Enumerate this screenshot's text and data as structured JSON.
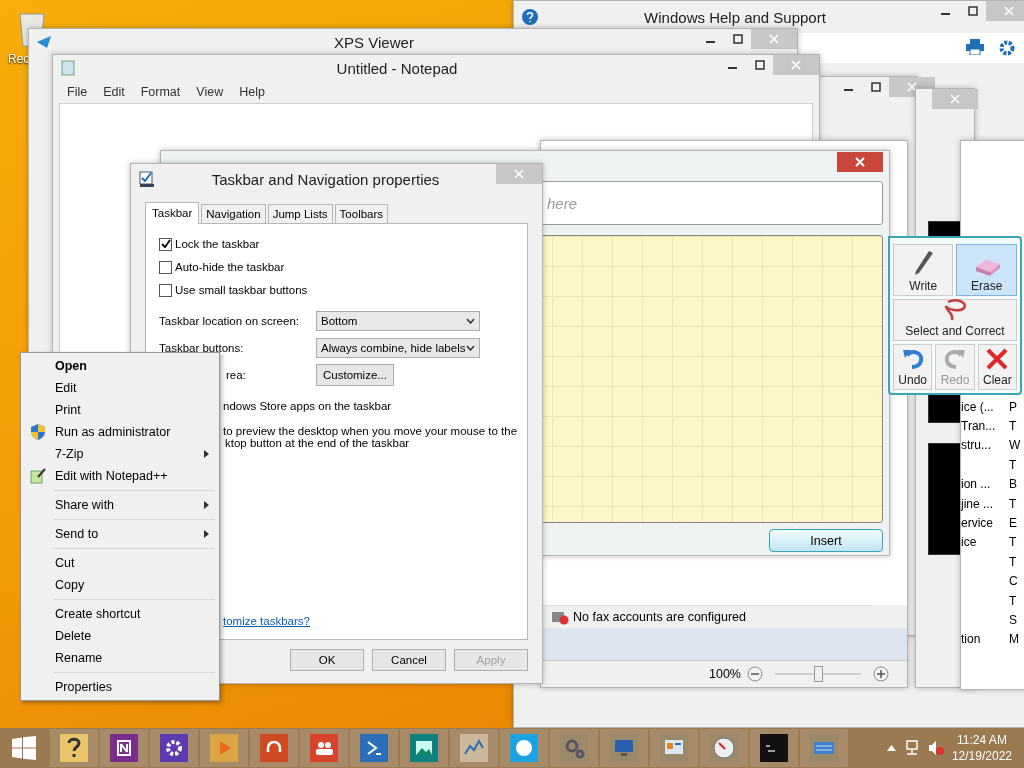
{
  "desktop": {
    "icons": [
      {
        "label": "Rec"
      }
    ]
  },
  "help_window": {
    "title": "Windows Help and Support"
  },
  "xps_viewer": {
    "title": "XPS Viewer"
  },
  "notepad": {
    "title": "Untitled - Notepad",
    "menu": [
      "File",
      "Edit",
      "Format",
      "View",
      "Help"
    ]
  },
  "math_input_panel": {
    "placeholder": "here",
    "insert_button": "Insert",
    "tools": [
      {
        "label": "Write",
        "kind": "write",
        "selected": false,
        "disabled": false
      },
      {
        "label": "Erase",
        "kind": "erase",
        "selected": true,
        "disabled": false
      },
      {
        "label": "Select and Correct",
        "kind": "select",
        "selected": false,
        "disabled": false
      },
      {
        "label": "Undo",
        "kind": "undo",
        "selected": false,
        "disabled": false
      },
      {
        "label": "Redo",
        "kind": "redo",
        "selected": false,
        "disabled": true
      },
      {
        "label": "Clear",
        "kind": "clear",
        "selected": false,
        "disabled": false
      }
    ]
  },
  "fax_window": {
    "status": "No fax accounts are configured",
    "zoom": {
      "reading": "100%",
      "level": 0.5
    }
  },
  "side_list": {
    "rows": [
      {
        "column_1": "ice (...",
        "column_2": "P"
      },
      {
        "column_1": "Tran...",
        "column_2": "T"
      },
      {
        "column_1": "stru...",
        "column_2": "W"
      },
      {
        "column_2": "T"
      },
      {
        "column_1": "ion ...",
        "column_2": "B"
      },
      {
        "column_1": "jine ...",
        "column_2": "T"
      },
      {
        "column_1": "ervice",
        "column_2": "E"
      },
      {
        "column_1": "ice",
        "column_2": "T"
      },
      {
        "column_2": "T"
      },
      {
        "column_2": "C"
      },
      {
        "column_2": "T"
      },
      {
        "column_2": "S"
      },
      {
        "column_1": "tion",
        "column_2": "M"
      }
    ]
  },
  "properties_dialog": {
    "title": "Taskbar and Navigation properties",
    "tabs": [
      {
        "label": "Taskbar",
        "selected": true
      },
      {
        "label": "Navigation",
        "selected": false
      },
      {
        "label": "Jump Lists",
        "selected": false
      },
      {
        "label": "Toolbars",
        "selected": false
      }
    ],
    "options": [
      {
        "label": "Lock the taskbar",
        "checked": true
      },
      {
        "label": "Auto-hide the taskbar",
        "checked": false
      },
      {
        "label": "Use small taskbar buttons",
        "checked": false
      }
    ],
    "fields": [
      {
        "label": "Taskbar location on screen:",
        "value": "Bottom"
      },
      {
        "label": "Taskbar buttons:",
        "value": "Always combine, hide labels"
      }
    ],
    "area_label": "rea:",
    "customize_button": "Customize...",
    "store_option": "ndows Store apps on the taskbar",
    "peek_option": [
      "to preview the desktop when you move your mouse to the",
      "ktop button at the end of the taskbar"
    ],
    "help_link": "tomize taskbars?",
    "buttons": [
      {
        "label": "OK",
        "disabled": false
      },
      {
        "label": "Cancel",
        "disabled": false
      },
      {
        "label": "Apply",
        "disabled": true
      }
    ]
  },
  "context_menu": {
    "groups": [
      [
        {
          "label": "Open",
          "default": true,
          "submenu": false,
          "kind": "plain"
        },
        {
          "label": "Edit",
          "default": false,
          "submenu": false,
          "kind": "plain"
        },
        {
          "label": "Print",
          "default": false,
          "submenu": false,
          "kind": "plain"
        },
        {
          "label": "Run as administrator",
          "default": false,
          "submenu": false,
          "kind": "shield"
        },
        {
          "label": "7-Zip",
          "default": false,
          "submenu": true,
          "kind": "plain"
        },
        {
          "label": "Edit with Notepad++",
          "default": false,
          "submenu": false,
          "kind": "notepad"
        }
      ],
      [
        {
          "label": "Share with",
          "default": false,
          "submenu": true,
          "kind": "plain"
        }
      ],
      [
        {
          "label": "Send to",
          "default": false,
          "submenu": true,
          "kind": "plain"
        }
      ],
      [
        {
          "label": "Cut",
          "default": false,
          "submenu": false,
          "kind": "plain"
        },
        {
          "label": "Copy",
          "default": false,
          "submenu": false,
          "kind": "plain"
        }
      ],
      [
        {
          "label": "Create shortcut",
          "default": false,
          "submenu": false,
          "kind": "plain"
        },
        {
          "label": "Delete",
          "default": false,
          "submenu": false,
          "kind": "plain"
        },
        {
          "label": "Rename",
          "default": false,
          "submenu": false,
          "kind": "plain"
        }
      ],
      [
        {
          "label": "Properties",
          "default": false,
          "submenu": false,
          "kind": "plain"
        }
      ]
    ]
  },
  "taskbar": {
    "clock": {
      "time": "11:24 AM",
      "date": "12/19/2022"
    }
  }
}
